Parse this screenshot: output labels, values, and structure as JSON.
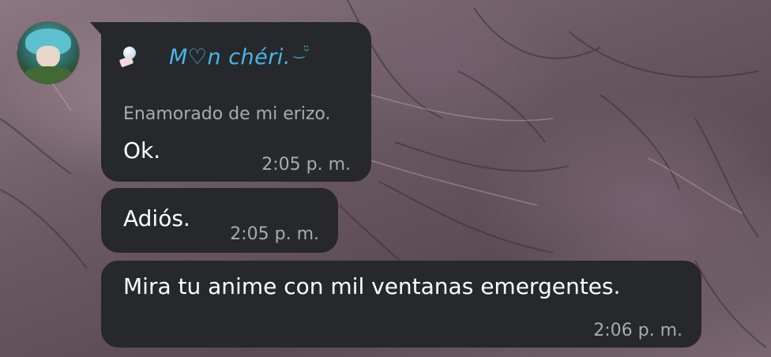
{
  "chat": {
    "sender": {
      "name": "M♡n chéri.",
      "decoration": "‿ᵕ̈",
      "status": "Enamorado de mi erizo.",
      "avatar_icon": "avatar-image",
      "badge_icon": "pin-icon"
    },
    "messages": [
      {
        "text": "Ok.",
        "time": "2:05 p. m."
      },
      {
        "text": "Adiós.",
        "time": "2:05 p. m."
      },
      {
        "text": "Mira tu anime con mil ventanas emergentes.",
        "time": "2:06 p. m."
      }
    ]
  },
  "colors": {
    "bubble": "#26282b",
    "sender_name": "#49b6e6",
    "meta_text": "#a9abad",
    "message_text": "#ffffff"
  }
}
